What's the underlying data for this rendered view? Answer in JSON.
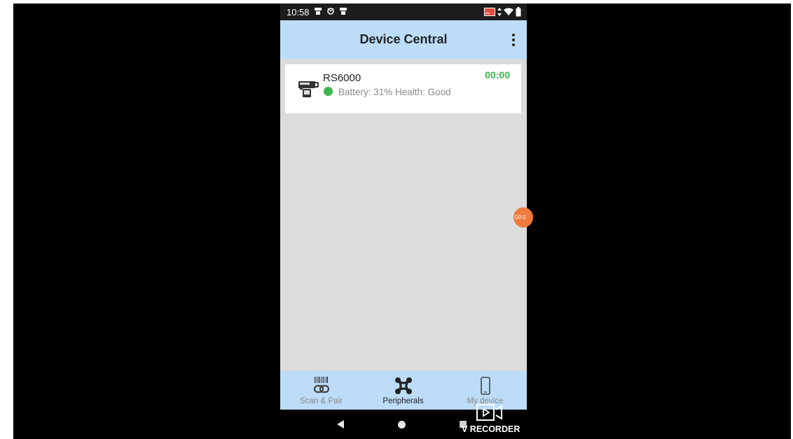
{
  "status_bar": {
    "time": "10:58"
  },
  "app_bar": {
    "title": "Device Central",
    "menu_icon": "overflow-menu-icon"
  },
  "devices": [
    {
      "name": "RS6000",
      "details": "Battery: 31% Health: Good",
      "timer": "00:00",
      "status_color": "#3cb54a",
      "icon": "scanner-device-icon"
    }
  ],
  "recorder_bubble": {
    "text": "00:0"
  },
  "bottom_nav": {
    "items": [
      {
        "label": "Scan & Pair",
        "icon": "barcode-link-icon",
        "active": false
      },
      {
        "label": "Peripherals",
        "icon": "peripherals-icon",
        "active": true
      },
      {
        "label": "My device",
        "icon": "phone-icon",
        "active": false
      }
    ]
  },
  "watermark": {
    "text": "V RECORDER"
  },
  "colors": {
    "accent_bar": "#bcdcf8",
    "status_ok": "#3cb54a",
    "recorder": "#f07b3f",
    "content_bg": "#dcdcdc"
  }
}
